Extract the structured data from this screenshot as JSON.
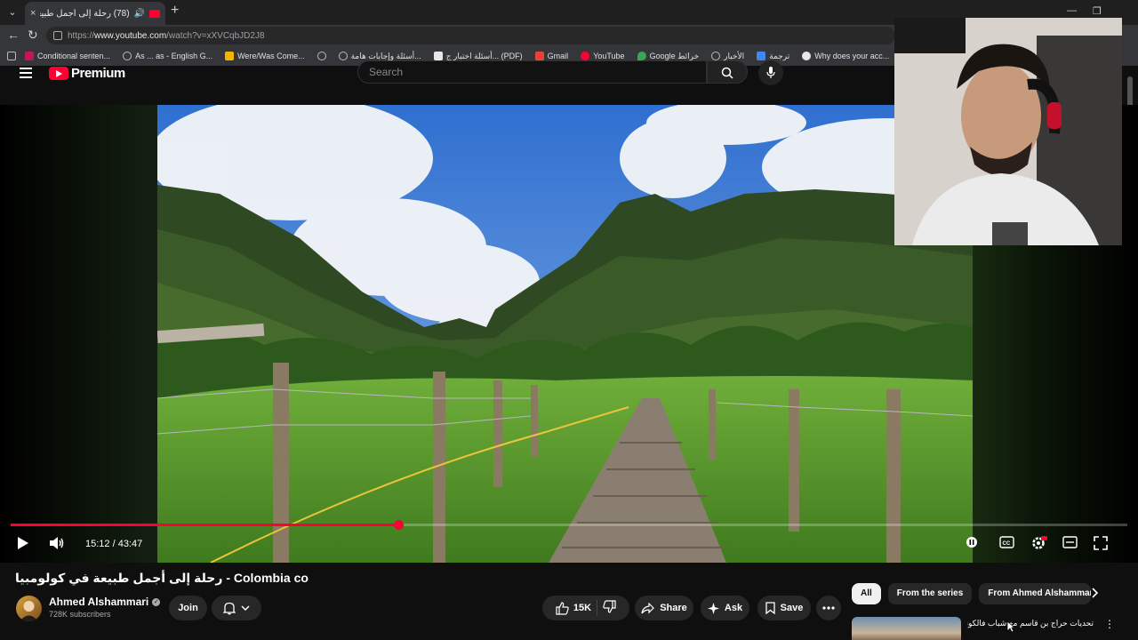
{
  "browser": {
    "tab_title": "(78) رحلة إلى أجمل طبيعة في ...",
    "url_prefix": "https://",
    "url_domain": "www.youtube.com",
    "url_path": "/watch?v=xXVCqbJD2J8",
    "bookmarks": [
      {
        "label": "Conditional senten...",
        "color": "#c2185b"
      },
      {
        "label": "As ... as - English G...",
        "color": ""
      },
      {
        "label": "Were/Was Come...",
        "color": "#f4b400"
      },
      {
        "label": "",
        "color": ""
      },
      {
        "label": "أسئلة وإجابات هامة...",
        "color": ""
      },
      {
        "label": "أسئلة اختبار ج... (PDF)",
        "color": "#e8e8e8"
      },
      {
        "label": "Gmail",
        "color": "#ea4335"
      },
      {
        "label": "YouTube",
        "color": "#ff0033"
      },
      {
        "label": "Google خرائط",
        "color": "#34a853"
      },
      {
        "label": "الأخبار",
        "color": ""
      },
      {
        "label": "ترجمة",
        "color": "#4285f4"
      },
      {
        "label": "Why does your acc...",
        "color": "#e8e8e8"
      },
      {
        "label": ".",
        "color": ""
      },
      {
        "label": "",
        "color": ""
      }
    ]
  },
  "header": {
    "logo_text": "Premium",
    "search_placeholder": "Search"
  },
  "player": {
    "time_display": "15:12 / 43:47",
    "progress_fraction": 0.3471
  },
  "video": {
    "title": "رحلة إلى أجمل طبيعة في كولومبيا - Colombia co",
    "channel_name": "Ahmed Alshammari",
    "subscribers": "728K subscribers",
    "join_label": "Join",
    "like_count": "15K",
    "share_label": "Share",
    "ask_label": "Ask",
    "save_label": "Save"
  },
  "sidebar": {
    "chips": [
      "All",
      "From the series",
      "From Ahmed Alshammari"
    ],
    "rec_title": "تحديات حراج بن قاسم مع شباب فالكونز"
  },
  "colors": {
    "accent": "#ff0033",
    "background": "#0f0f0f"
  }
}
